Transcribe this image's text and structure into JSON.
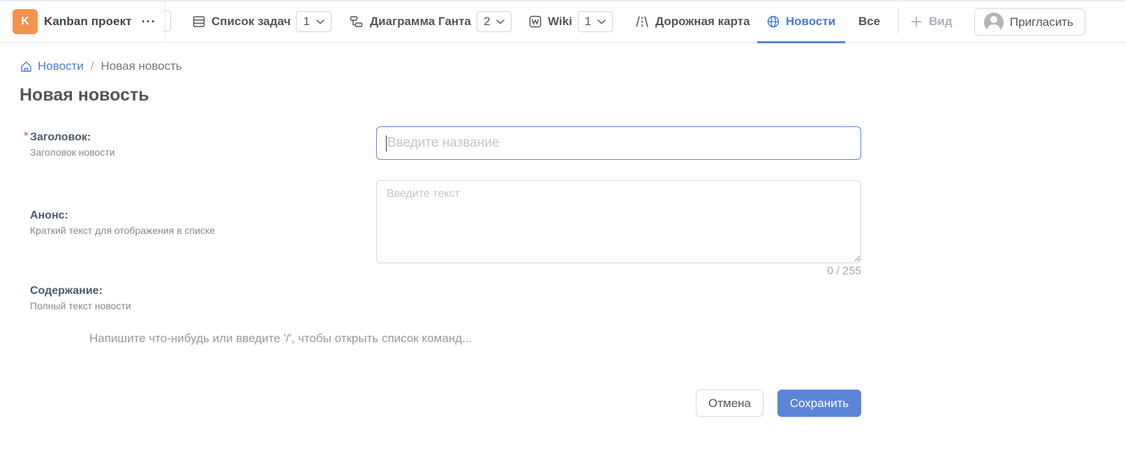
{
  "project": {
    "initial": "K",
    "name": "Kanban проект",
    "more": "···",
    "avatar_color": "#f5924e"
  },
  "tabs": [
    {
      "label": "Список задач",
      "count": "1",
      "icon": "list-icon"
    },
    {
      "label": "Диаграмма Ганта",
      "count": "2",
      "icon": "gantt-icon"
    },
    {
      "label": "Wiki",
      "count": "1",
      "icon": "wiki-icon"
    },
    {
      "label": "Дорожная карта",
      "icon": "road-icon"
    },
    {
      "label": "Новости",
      "icon": "globe-icon",
      "active": true
    },
    {
      "label": "Все"
    }
  ],
  "view_button": {
    "label": "Вид",
    "icon": "plus-icon"
  },
  "invite_button": {
    "label": "Пригласить",
    "icon": "user-avatar-icon"
  },
  "breadcrumb": {
    "home_label": "Новости",
    "separator": "/",
    "current": "Новая новость"
  },
  "page_title": "Новая новость",
  "form": {
    "title_field": {
      "required_mark": "*",
      "label": "Заголовок:",
      "hint": "Заголовок новости",
      "placeholder": "Введите название",
      "value": ""
    },
    "anons_field": {
      "label": "Анонс:",
      "hint": "Краткий текст для отображения в списке",
      "placeholder": "Введите текст",
      "value": "",
      "counter": "0 / 255"
    },
    "content_field": {
      "label": "Содержание:",
      "hint": "Полный текст новости",
      "placeholder": "Напишите что-нибудь или введите '/', чтобы открыть список команд..."
    }
  },
  "actions": {
    "cancel_label": "Отмена",
    "save_label": "Сохранить"
  },
  "colors": {
    "accent": "#5b86d8",
    "required": "#e34d4d"
  }
}
